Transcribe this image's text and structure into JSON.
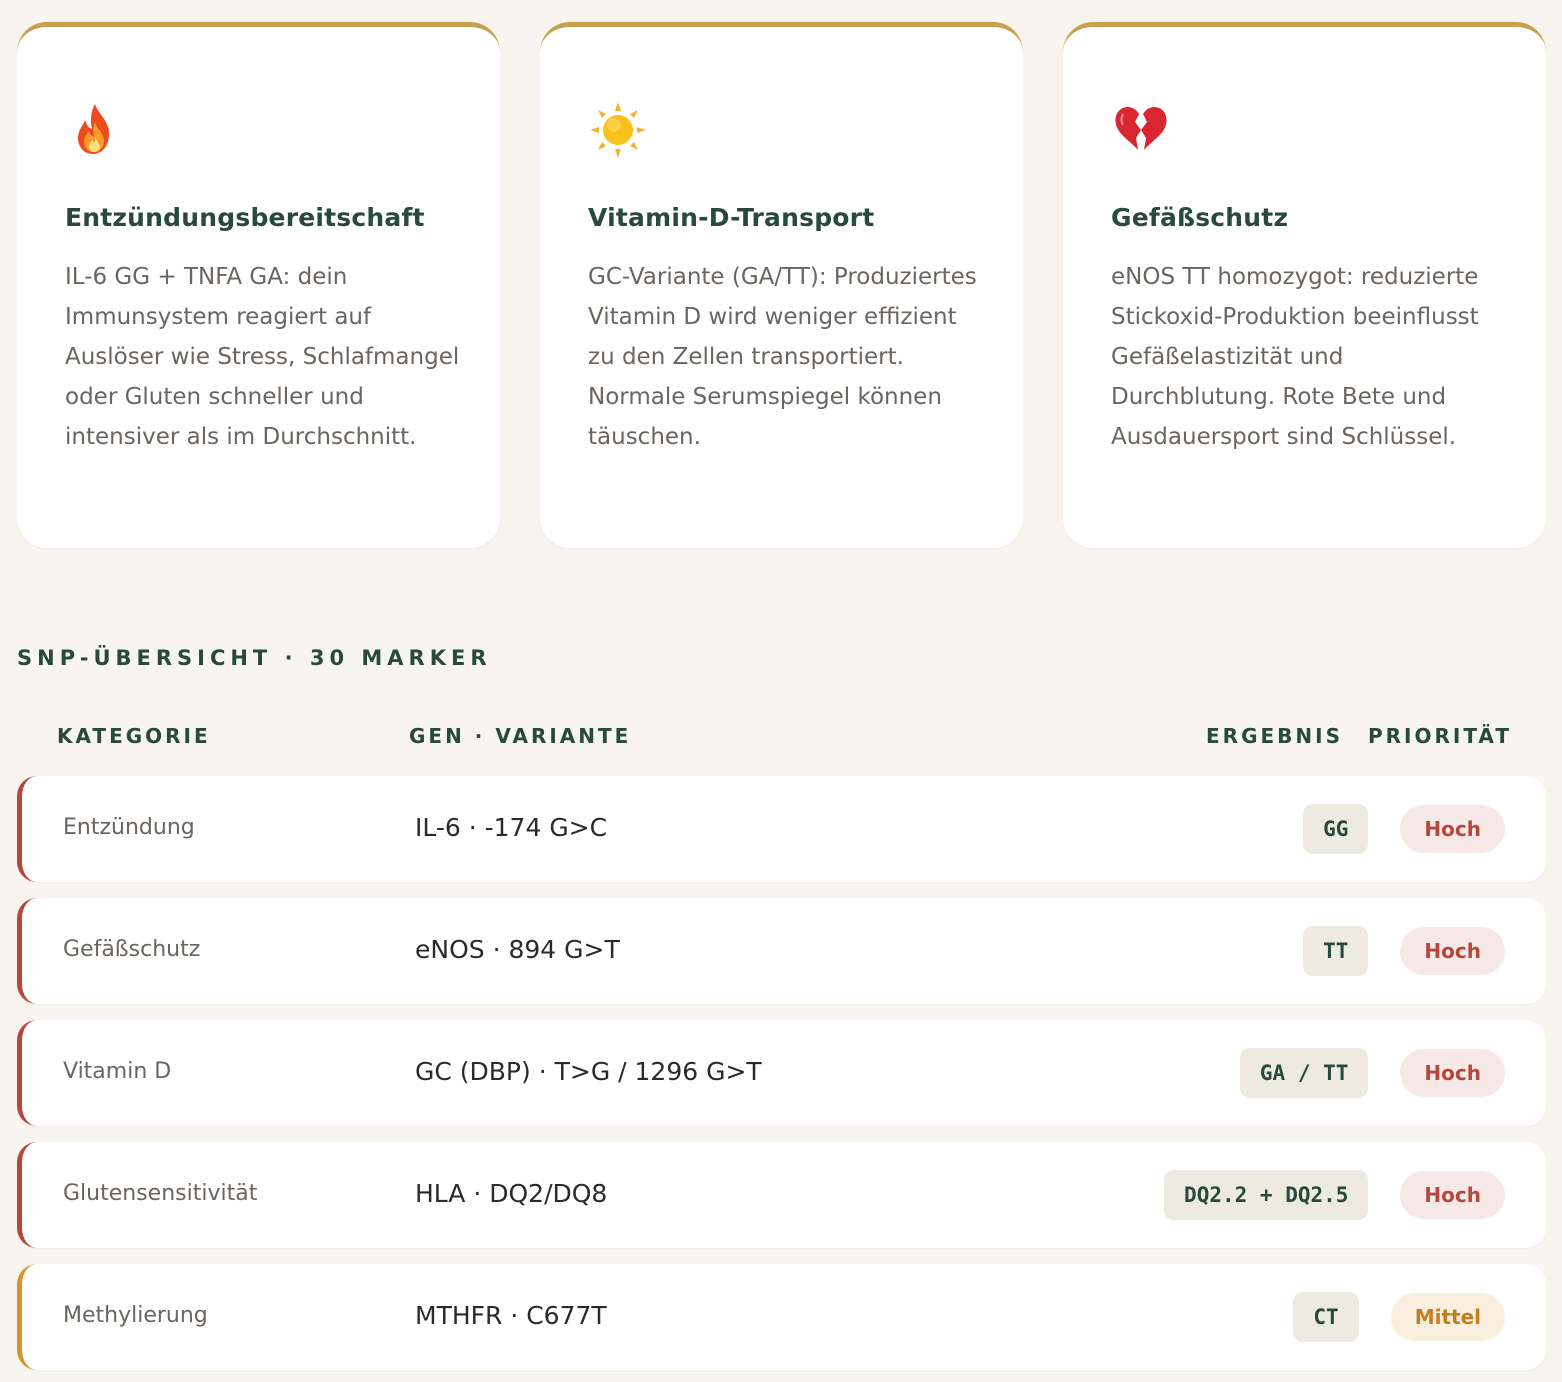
{
  "cards": [
    {
      "icon": "fire-icon",
      "title": "Entzündungsbereitschaft",
      "text": "IL-6 GG + TNFA GA: dein Immunsystem reagiert auf Auslöser wie Stress, Schlafmangel oder Gluten schneller und intensiver als im Durchschnitt."
    },
    {
      "icon": "sun-icon",
      "title": "Vitamin-D-Transport",
      "text": "GC-Variante (GA/TT): Produziertes Vitamin D wird weniger effizient zu den Zellen transportiert. Normale Serumspiegel können täuschen."
    },
    {
      "icon": "broken-heart-icon",
      "title": "Gefäßschutz",
      "text": "eNOS TT homozygot: reduzierte Stickoxid-Produktion beeinflusst Gefäßelastizität und Durchblutung. Rote Bete und Ausdauersport sind Schlüssel."
    }
  ],
  "section": {
    "title": "SNP-ÜBERSICHT · 30 MARKER"
  },
  "table": {
    "headers": {
      "category": "KATEGORIE",
      "gene": "GEN · VARIANTE",
      "result": "ERGEBNIS",
      "priority": "PRIORITÄT"
    },
    "rows": [
      {
        "category": "Entzündung",
        "gene": "IL-6 · -174 G>C",
        "result": "GG",
        "priority": "Hoch"
      },
      {
        "category": "Gefäßschutz",
        "gene": "eNOS · 894 G>T",
        "result": "TT",
        "priority": "Hoch"
      },
      {
        "category": "Vitamin D",
        "gene": "GC (DBP) · T>G / 1296 G>T",
        "result": "GA / TT",
        "priority": "Hoch"
      },
      {
        "category": "Glutensensitivität",
        "gene": "HLA · DQ2/DQ8",
        "result": "DQ2.2 + DQ2.5",
        "priority": "Hoch"
      },
      {
        "category": "Methylierung",
        "gene": "MTHFR · C677T",
        "result": "CT",
        "priority": "Mittel"
      }
    ]
  },
  "colors": {
    "accent_gold": "#c9a14e",
    "heading_green": "#284a3c",
    "priority_high": "#b5483c",
    "priority_medium": "#d4952e"
  }
}
